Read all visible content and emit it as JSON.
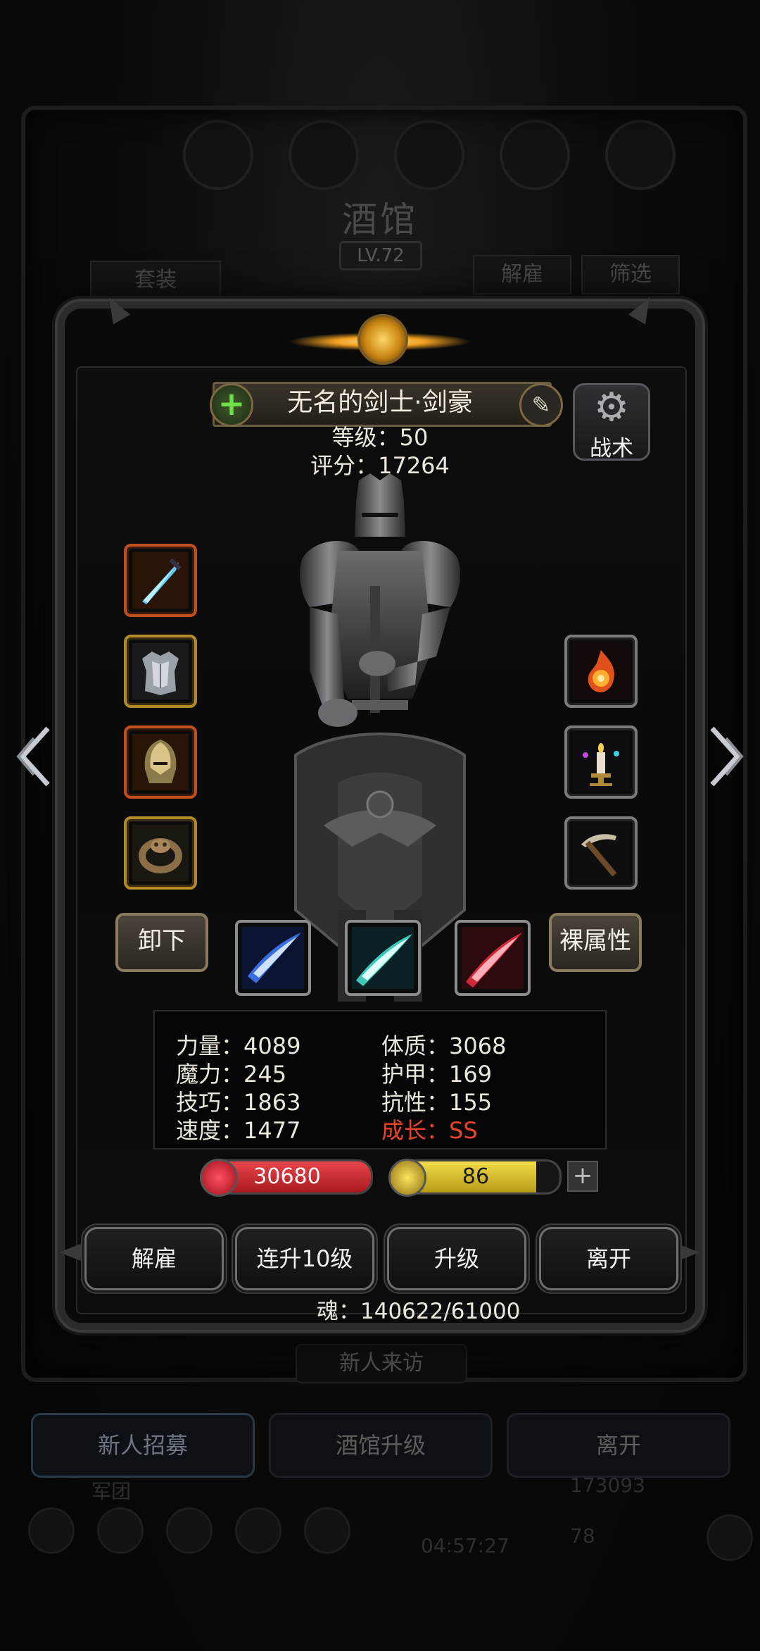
{
  "background": {
    "title": "酒馆",
    "level": "LV.72",
    "left_tab": "套装",
    "right_tabs": [
      "解雇",
      "筛选"
    ],
    "new_visitor": "新人来访",
    "bottom_buttons": [
      "新人招募",
      "酒馆升级",
      "离开"
    ],
    "guild_label": "军团",
    "gold_amount": "173093",
    "timer": "04:57:27",
    "gem_amount": "78"
  },
  "hero": {
    "name": "无名的剑士·剑豪",
    "level_line": "等级：50",
    "score_line": "评分：17264",
    "tactics_label": "战术",
    "unequip_label": "卸下",
    "naked_attr_label": "裸属性"
  },
  "equipment_left": [
    {
      "name": "sword",
      "frame": "orange"
    },
    {
      "name": "armor",
      "frame": "gold"
    },
    {
      "name": "helmet",
      "frame": "orange"
    },
    {
      "name": "ring",
      "frame": "gold"
    }
  ],
  "equipment_right": [
    {
      "name": "fire-orb",
      "frame": "gray"
    },
    {
      "name": "candle",
      "frame": "gray"
    },
    {
      "name": "pickaxe",
      "frame": "gray"
    }
  ],
  "skills": [
    {
      "name": "blue-slash",
      "color": "#3a6ee0"
    },
    {
      "name": "cyan-slash",
      "color": "#3ec8b8"
    },
    {
      "name": "red-slash",
      "color": "#d0283a"
    }
  ],
  "stats": {
    "strength": "力量：4089",
    "magic": "魔力：245",
    "skill": "技巧：1863",
    "speed": "速度：1477",
    "constitution": "体质：3068",
    "armor": "护甲：169",
    "resistance": "抗性：155",
    "growth_label": "成长：",
    "growth_value": "SS"
  },
  "bars": {
    "hp_value": "30680",
    "hp_fraction": 1.0,
    "energy_value": "86",
    "energy_fraction": 0.86
  },
  "actions": [
    "解雇",
    "连升10级",
    "升级",
    "离开"
  ],
  "soul_line": "魂：140622/61000",
  "colors": {
    "accent_gold": "#b28a28",
    "accent_orange": "#c0501e",
    "hp_red": "#c8242a",
    "energy_yellow": "#d8c02a",
    "growth_red": "#e8442a"
  }
}
